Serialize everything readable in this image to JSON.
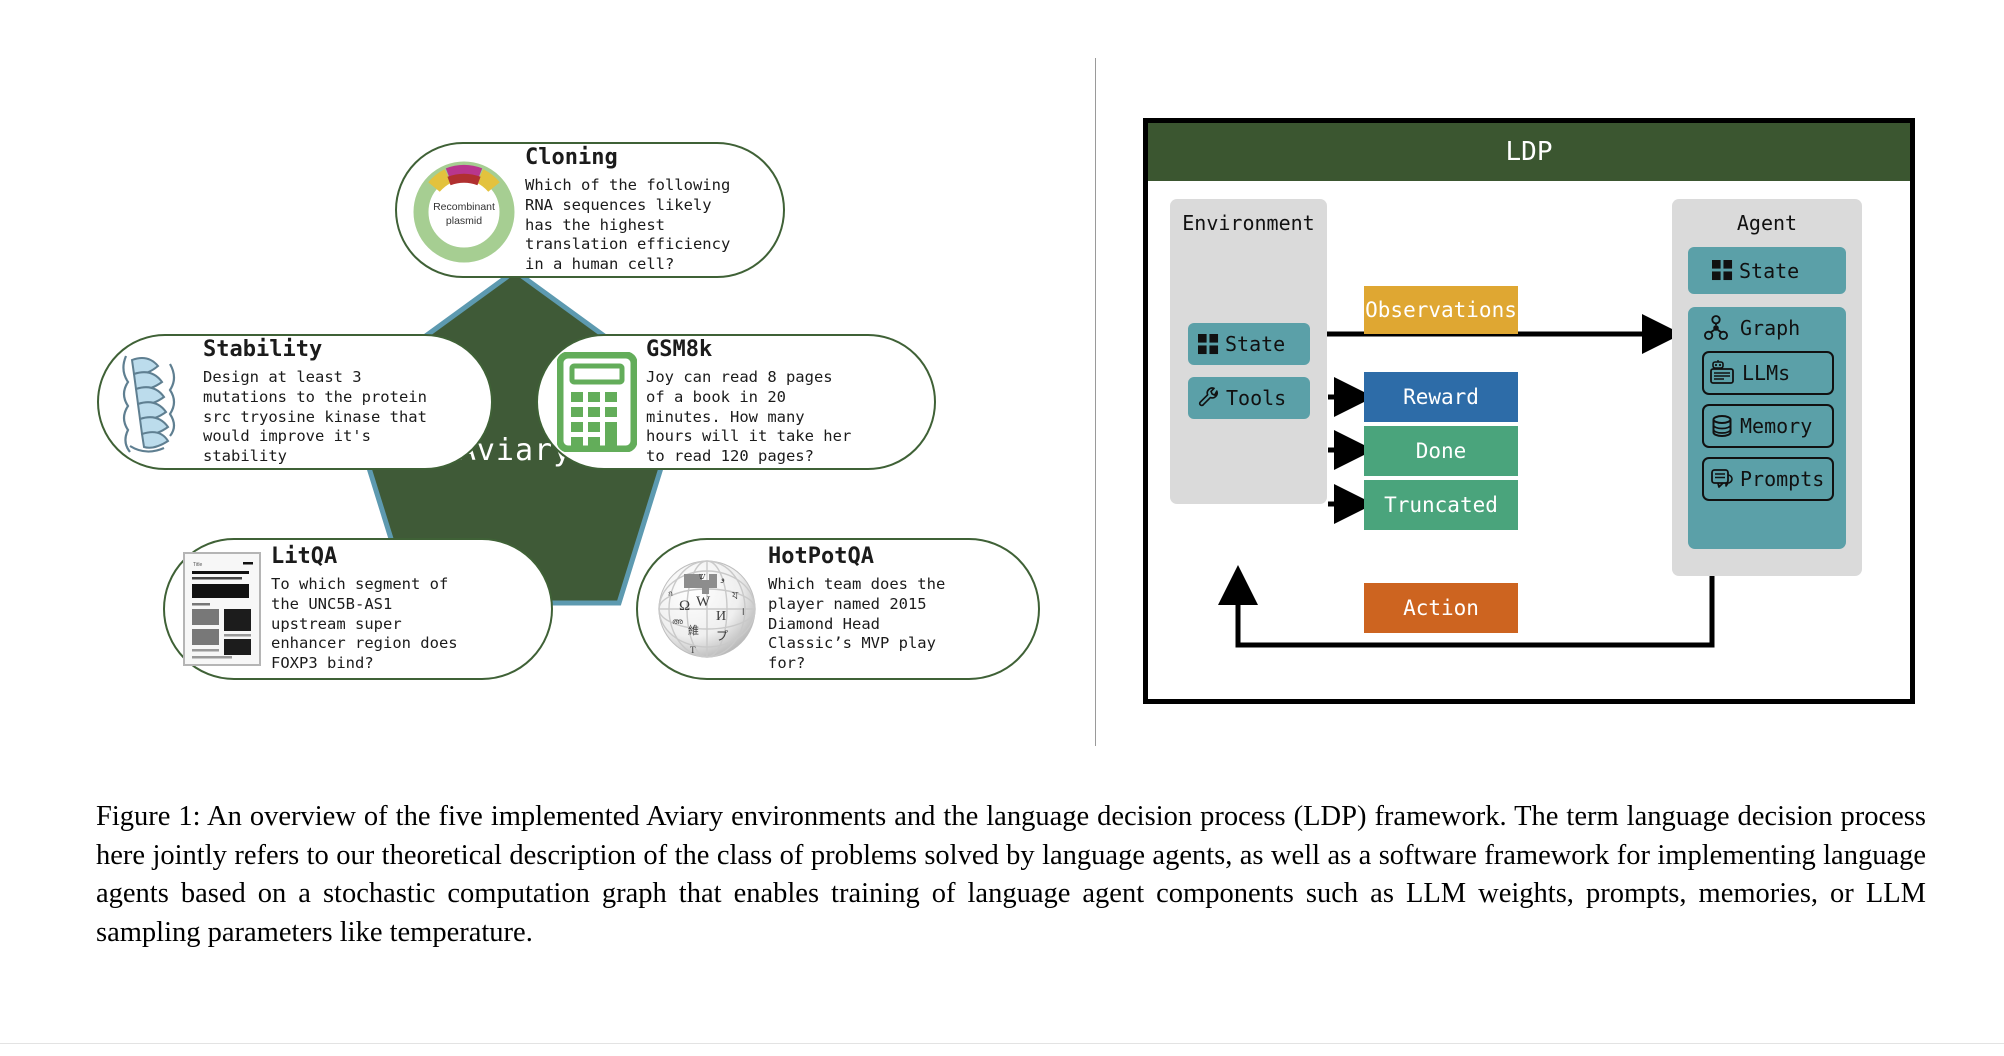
{
  "figure": {
    "caption": "Figure 1:  An overview of the five implemented Aviary environments and the language decision process (LDP) framework.  The term language decision process here jointly refers to our theoretical description of the class of problems solved by language agents, as well as a software framework for implementing language agents based on a stochastic computation graph that enables training of language agent components such as LLM weights, prompts, memories, or LLM sampling parameters like temperature."
  },
  "colors": {
    "node_border": "#3f6136",
    "pentagon_fill": "#3f5a37",
    "pentagon_stroke": "#5d9ab0",
    "ldp_header": "#3b5630",
    "gray_panel": "#dadada",
    "teal_chip": "#5ba0a8",
    "observations": "#dfa732",
    "reward": "#2d6ca8",
    "done": "#4aa47c",
    "truncated": "#4aa47c",
    "action": "#cd6420"
  },
  "left_panel": {
    "center_label": "Aviary",
    "nodes": [
      {
        "id": "cloning",
        "title": "Cloning",
        "icon": "plasmid-icon",
        "icon_caption": "Recombinant plasmid",
        "question": "Which of the following\nRNA sequences likely\nhas the highest\ntranslation efficiency\nin a human cell?"
      },
      {
        "id": "stability",
        "title": "Stability",
        "icon": "protein-structure-icon",
        "question": "Design at least 3\nmutations to the protein\nsrc tryosine kinase that\nwould improve it's\nstability"
      },
      {
        "id": "gsm8k",
        "title": "GSM8k",
        "icon": "calculator-icon",
        "question": "Joy can read 8 pages\nof a book in 20\nminutes. How many\nhours will it take her\nto read 120 pages?"
      },
      {
        "id": "litqa",
        "title": "LitQA",
        "icon": "paper-document-icon",
        "question": "To which segment of\nthe UNC5B-AS1\nupstream super\nenhancer region does\nFOXP3 bind?"
      },
      {
        "id": "hotpotqa",
        "title": "HotPotQA",
        "icon": "wikipedia-globe-icon",
        "question": "Which team does the\nplayer named 2015\nDiamond Head\nClassic’s MVP play\nfor?"
      }
    ]
  },
  "ldp": {
    "title": "LDP",
    "environment": {
      "title": "Environment",
      "chips": [
        {
          "label": "State",
          "icon": "grid-squares-icon"
        },
        {
          "label": "Tools",
          "icon": "wrench-icon"
        }
      ]
    },
    "messages": [
      {
        "label": "Observations",
        "color": "#dfa732"
      },
      {
        "label": "Reward",
        "color": "#2d6ca8"
      },
      {
        "label": "Done",
        "color": "#4aa47c"
      },
      {
        "label": "Truncated",
        "color": "#4aa47c"
      },
      {
        "label": "Action",
        "color": "#cd6420"
      }
    ],
    "agent": {
      "title": "Agent",
      "state_chip": {
        "label": "State",
        "icon": "grid-squares-icon"
      },
      "graph_chip": {
        "label": "Graph",
        "icon": "graph-nodes-icon",
        "children": [
          {
            "label": "LLMs",
            "icon": "robot-card-icon"
          },
          {
            "label": "Memory",
            "icon": "database-icon"
          },
          {
            "label": "Prompts",
            "icon": "chat-bubble-icon"
          }
        ]
      }
    }
  }
}
